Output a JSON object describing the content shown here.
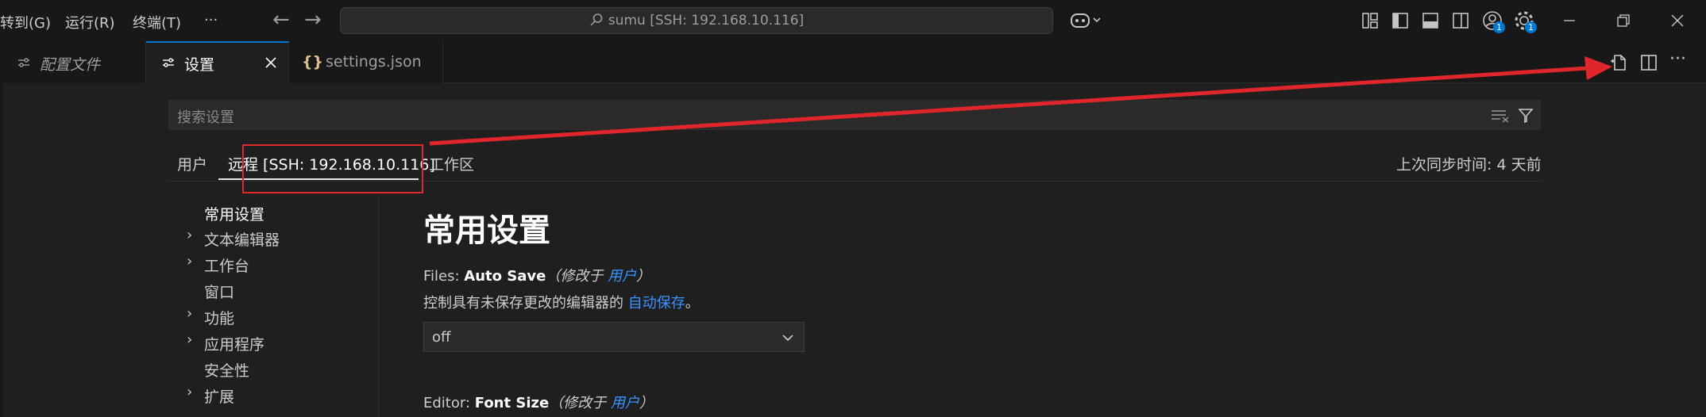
{
  "menu": [
    "转到(G)",
    "运行(R)",
    "终端(T)",
    "···"
  ],
  "command_center": {
    "text": "sumu [SSH: 192.168.10.116]"
  },
  "badges": {
    "accounts": "1",
    "manage": "1"
  },
  "tabs": [
    {
      "label": "配置文件",
      "active": false
    },
    {
      "label": "设置",
      "active": true
    },
    {
      "label": "settings.json",
      "active": false
    }
  ],
  "search": {
    "placeholder": "搜索设置"
  },
  "scopes": {
    "user": "用户",
    "remote": "远程 [SSH: 192.168.10.116]",
    "workspace": "工作区"
  },
  "sync_status": "上次同步时间: 4 天前",
  "toc": [
    {
      "label": "常用设置",
      "expandable": false
    },
    {
      "label": "文本编辑器",
      "expandable": true
    },
    {
      "label": "工作台",
      "expandable": true
    },
    {
      "label": "窗口",
      "expandable": false
    },
    {
      "label": "功能",
      "expandable": true
    },
    {
      "label": "应用程序",
      "expandable": true
    },
    {
      "label": "安全性",
      "expandable": false
    },
    {
      "label": "扩展",
      "expandable": true
    }
  ],
  "section_title": "常用设置",
  "settings": [
    {
      "category": "Files: ",
      "name": "Auto Save",
      "modified_prefix": "（修改于 ",
      "modified_link": "用户",
      "modified_suffix": "）",
      "desc_prefix": "控制具有未保存更改的编辑器的 ",
      "desc_link": "自动保存",
      "desc_suffix": "。",
      "value": "off"
    },
    {
      "category": "Editor: ",
      "name": "Font Size",
      "modified_prefix": "（修改于 ",
      "modified_link": "用户",
      "modified_suffix": "）"
    }
  ],
  "colors": {
    "accent": "#0078d4",
    "annotation": "#e0262b",
    "link": "#3794ff"
  }
}
